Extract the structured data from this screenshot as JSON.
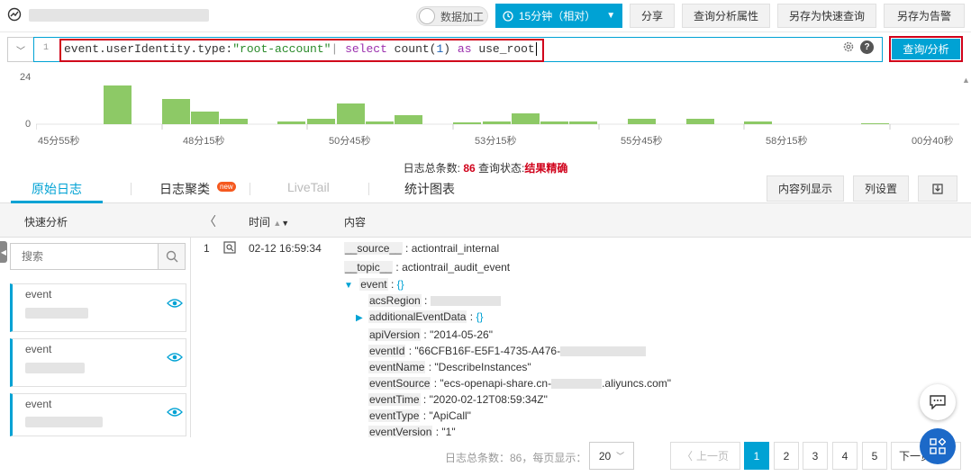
{
  "topbar": {
    "toggle_label": "数据加工",
    "time_range": "15分钟（相对）",
    "buttons": [
      "分享",
      "查询分析属性",
      "另存为快速查询",
      "另存为告警"
    ]
  },
  "query": {
    "line_number": "1",
    "part_key": "event.userIdentity.type:",
    "part_value": "\"root-account\"",
    "part_pipe": "| ",
    "part_select": "select",
    "part_func": " count(",
    "part_num": "1",
    "part_close": ") ",
    "part_as": "as",
    "part_alias": " use_root",
    "search_button": "查询/分析",
    "help": "?"
  },
  "histogram": {
    "y_max": "24",
    "y_min": "0",
    "x_labels": [
      "45分55秒",
      "48分15秒",
      "50分45秒",
      "53分15秒",
      "55分45秒",
      "58分15秒",
      "00分40秒"
    ]
  },
  "stats": {
    "total_label": "日志总条数:",
    "total_value": "86",
    "status_label": "查询状态:",
    "status_value": "结果精确"
  },
  "tabs": [
    "原始日志",
    "日志聚类",
    "LiveTail",
    "统计图表"
  ],
  "new_badge": "new",
  "right_buttons": [
    "内容列显示",
    "列设置"
  ],
  "left_panel": {
    "title": "快速分析",
    "search_placeholder": "搜索",
    "fields": [
      "event",
      "event",
      "event"
    ]
  },
  "table": {
    "col_time": "时间",
    "col_content": "内容",
    "row_num": "1",
    "row_time": "02-12 16:59:34"
  },
  "log": {
    "source_key": "__source__",
    "source_val": "actiontrail_internal",
    "topic_key": "__topic__",
    "topic_val": "actiontrail_audit_event",
    "event_key": "event",
    "event_brace": "{}",
    "acsRegion_key": "acsRegion",
    "additional_key": "additionalEventData",
    "additional_brace": "{}",
    "apiVersion_key": "apiVersion",
    "apiVersion_val": "\"2014-05-26\"",
    "eventId_key": "eventId",
    "eventId_val": "\"66CFB16F-E5F1-4735-A476-",
    "eventName_key": "eventName",
    "eventName_val": "\"DescribeInstances\"",
    "eventSource_key": "eventSource",
    "eventSource_val1": "\"ecs-openapi-share.cn-",
    "eventSource_val2": ".aliyuncs.com\"",
    "eventTime_key": "eventTime",
    "eventTime_val": "\"2020-02-12T08:59:34Z\"",
    "eventType_key": "eventType",
    "eventType_val": "\"ApiCall\"",
    "eventVersion_key": "eventVersion",
    "eventVersion_val": "\"1\""
  },
  "footer": {
    "total_text": "日志总条数：86，每页显示：",
    "page_size": "20",
    "prev": "上一页",
    "pages": [
      "1",
      "2",
      "3",
      "4",
      "5"
    ],
    "next": "下一页"
  },
  "colors": {
    "accent": "#00a2d4",
    "highlight_border": "#d0021b",
    "bar": "#8dc966"
  }
}
